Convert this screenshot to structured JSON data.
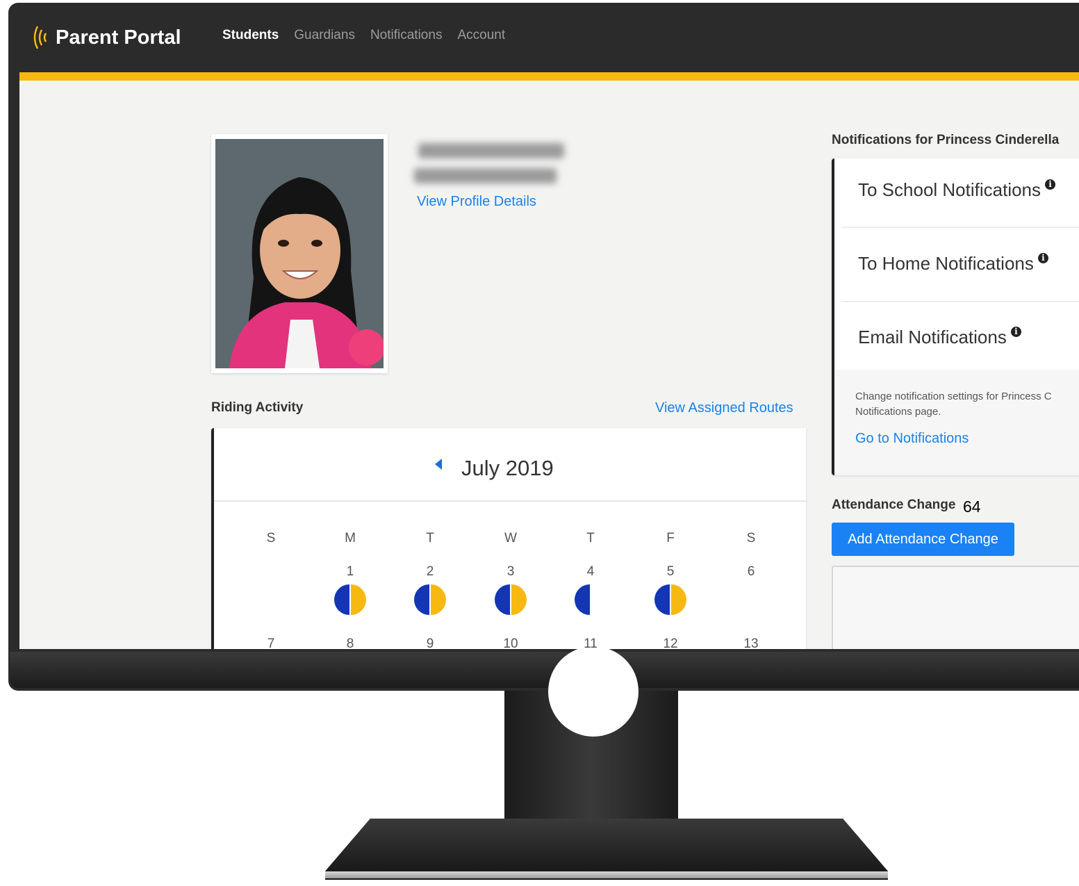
{
  "app": {
    "brand": "Parent Portal"
  },
  "nav": {
    "items": [
      {
        "label": "Students",
        "active": true
      },
      {
        "label": "Guardians",
        "active": false
      },
      {
        "label": "Notifications",
        "active": false
      },
      {
        "label": "Account",
        "active": false
      }
    ]
  },
  "profile": {
    "view_details_label": "View Profile Details"
  },
  "riding": {
    "heading": "Riding Activity",
    "view_routes_label": "View Assigned Routes",
    "month_label": "July 2019",
    "weekdays": [
      "S",
      "M",
      "T",
      "W",
      "T",
      "F",
      "S"
    ],
    "week1": [
      "",
      "1",
      "2",
      "3",
      "4",
      "5",
      "6"
    ],
    "week2": [
      "7",
      "8",
      "9",
      "10",
      "11",
      "12",
      "13"
    ],
    "rides": [
      {
        "day": "1",
        "to_school": true,
        "to_home": true
      },
      {
        "day": "2",
        "to_school": true,
        "to_home": true
      },
      {
        "day": "3",
        "to_school": true,
        "to_home": true
      },
      {
        "day": "4",
        "to_school": true,
        "to_home": false
      },
      {
        "day": "5",
        "to_school": true,
        "to_home": true
      }
    ]
  },
  "notifications": {
    "heading": "Notifications for Princess Cinderella",
    "to_school": "To School Notifications",
    "to_home": "To Home Notifications",
    "email": "Email Notifications",
    "change_text": "Change notification settings for Princess C",
    "change_text_2": "Notifications page.",
    "go_label": "Go to Notifications"
  },
  "attendance": {
    "heading": "Attendance Change",
    "count": "64",
    "add_label": "Add Attendance Change"
  },
  "colors": {
    "topbar": "#2b2b2b",
    "accent": "#f7b911",
    "link": "#1a82e8",
    "button": "#1a82f5",
    "ride_to_school": "#1436b5",
    "ride_to_home": "#f7b911"
  }
}
